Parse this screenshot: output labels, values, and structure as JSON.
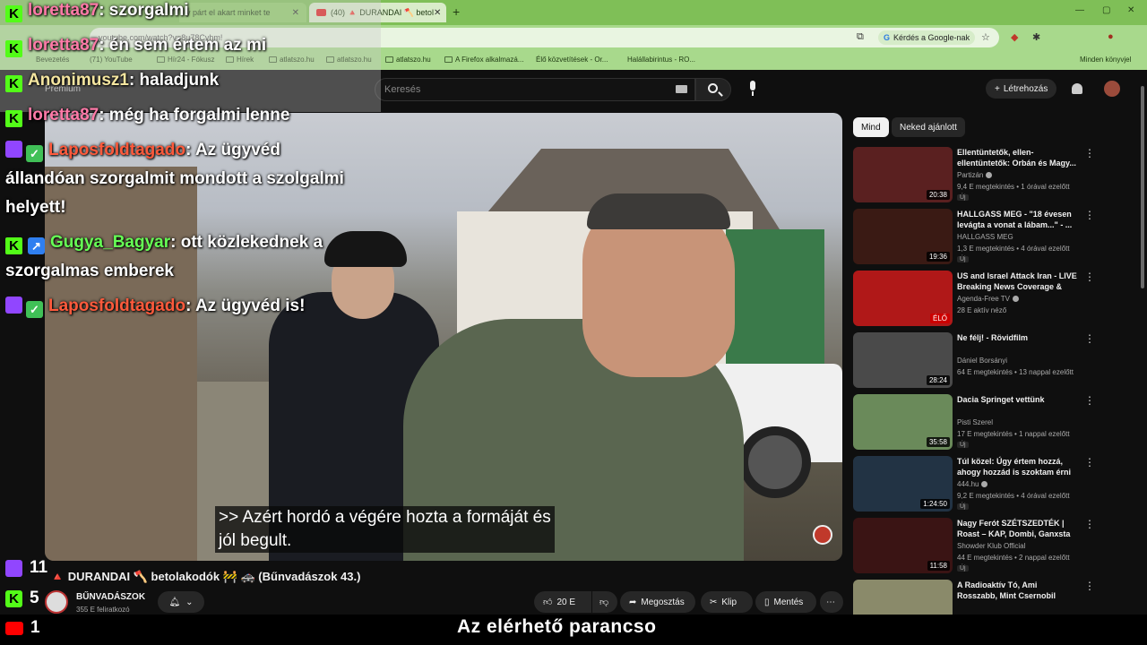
{
  "browser": {
    "tabs": [
      {
        "label": "y párt el akart minket te"
      },
      {
        "label": "(40) 🔺 DURANDAI 🪓 betol"
      }
    ],
    "newtab": "+",
    "url": "youtube.com/watch?v=8u78Cvhm!",
    "google_chip": "Kérdés a Google-nak",
    "bookmarks": [
      {
        "label": "Bevezetés"
      },
      {
        "label": "(71) YouTube"
      },
      {
        "label": "Hír24 - Fókusz"
      },
      {
        "label": "Hírek"
      },
      {
        "label": "atlatszo.hu"
      },
      {
        "label": "atlatszo.hu"
      },
      {
        "label": "atlatszo.hu"
      },
      {
        "label": "A Firefox alkalmazá..."
      },
      {
        "label": "Élő közvetítések - Or..."
      },
      {
        "label": "Halállabirintus - RO..."
      }
    ],
    "other_bookmarks": "Minden könyvjel"
  },
  "youtube": {
    "premium": "Premium",
    "search_placeholder": "Keresés",
    "create_label": "Létrehozás",
    "video": {
      "subtitle_line1": ">> Azért hordó a végére hozta a formáját és",
      "subtitle_line2": "jól begult.",
      "title": "🔺 DURANDAI 🪓 betolakodók 🚧 🚓 (Bűnvadászok 43.)"
    },
    "channel": {
      "name": "BŰNVADÁSZOK",
      "subs": "355 E feliratkozó"
    },
    "actions": {
      "like": "20 E",
      "share": "Megosztás",
      "clip": "Klip",
      "save": "Mentés",
      "more": "⋯"
    },
    "chips": [
      {
        "label": "Mind"
      },
      {
        "label": "Neked ajánlott"
      }
    ],
    "recommendations": [
      {
        "title": "Ellentüntetők, ellen-ellentüntetők: Orbán és Magy...",
        "channel": "Partizán",
        "verified": true,
        "meta": "9,4 E megtekintés • 1 órával ezelőtt",
        "badge": "Új",
        "duration": "20:38",
        "thumb": "#5a2020"
      },
      {
        "title": "HALLGASS MEG - \"18 évesen levágta a vonat a lábam...\" - ...",
        "channel": "HALLGASS MEG",
        "verified": false,
        "meta": "1,3 E megtekintés • 4 órával ezelőtt",
        "badge": "Új",
        "duration": "19:36",
        "thumb": "#3a1a14"
      },
      {
        "title": "US and Israel Attack Iran - LIVE Breaking News Coverage & W...",
        "channel": "Agenda-Free TV",
        "verified": true,
        "meta": "28 E aktív néző",
        "badge": "",
        "duration": "ÉLŐ",
        "live": true,
        "thumb": "#b01818"
      },
      {
        "title": "Ne félj! - Rövidfilm",
        "channel": "Dániel Borsányi",
        "verified": false,
        "meta": "64 E megtekintés • 13 nappal ezelőtt",
        "badge": "",
        "duration": "28:24",
        "thumb": "#4a4a4a"
      },
      {
        "title": "Dacia Springet vettünk",
        "channel": "Pisti Szerel",
        "verified": false,
        "meta": "17 E megtekintés • 1 nappal ezelőtt",
        "badge": "Új",
        "duration": "35:58",
        "thumb": "#6a8a5a"
      },
      {
        "title": "Túl közel: Úgy értem hozzá, ahogy hozzád is szoktam érni",
        "channel": "444.hu",
        "verified": true,
        "meta": "9,2 E megtekintés • 4 órával ezelőtt",
        "badge": "Új",
        "duration": "1:24:50",
        "thumb": "#223344"
      },
      {
        "title": "Nagy Ferót SZÉTSZEDTÉK | Roast – KAP, Dombi, Ganxsta",
        "channel": "Showder Klub Official",
        "verified": false,
        "meta": "44 E megtekintés • 2 nappal ezelőtt",
        "badge": "Új",
        "duration": "11:58",
        "thumb": "#3a1414"
      },
      {
        "title": "A Radioaktív Tó, Ami Rosszabb, Mint Csernobil",
        "channel": "",
        "verified": false,
        "meta": "",
        "badge": "",
        "duration": "",
        "thumb": "#8a8a6a"
      }
    ]
  },
  "chat": [
    {
      "platform": "kick",
      "badges": [],
      "user": "loretta87",
      "color": "pink",
      "msg": ": szorgalmi"
    },
    {
      "platform": "kick",
      "badges": [],
      "user": "loretta87",
      "color": "pink",
      "msg": ": én sem értem az mi"
    },
    {
      "platform": "kick",
      "badges": [],
      "user": "Anonimusz1",
      "color": "yellow",
      "msg": ": haladjunk"
    },
    {
      "platform": "kick",
      "badges": [],
      "user": "loretta87",
      "color": "pink",
      "msg": ": még ha forgalmi lenne"
    },
    {
      "platform": "twitch",
      "badges": [
        "green"
      ],
      "user": "Laposfoldtagado",
      "color": "red",
      "msg": ": Az ügyvéd",
      "cont": [
        "állandóan szorgalmit mondott a szolgalmi",
        "helyett!"
      ]
    },
    {
      "platform": "kick",
      "badges": [
        "blue"
      ],
      "user": "Gugya_Bagyar",
      "color": "green",
      "msg": ": ott közlekednek a",
      "cont": [
        "szorgalmas emberek"
      ]
    },
    {
      "platform": "twitch",
      "badges": [
        "green"
      ],
      "user": "Laposfoldtagado",
      "color": "red",
      "msg": ": Az ügyvéd is!"
    }
  ],
  "viewers": {
    "twitch": "11",
    "kick": "5",
    "youtube": "1"
  },
  "ticker": "Az elérhető parancso"
}
